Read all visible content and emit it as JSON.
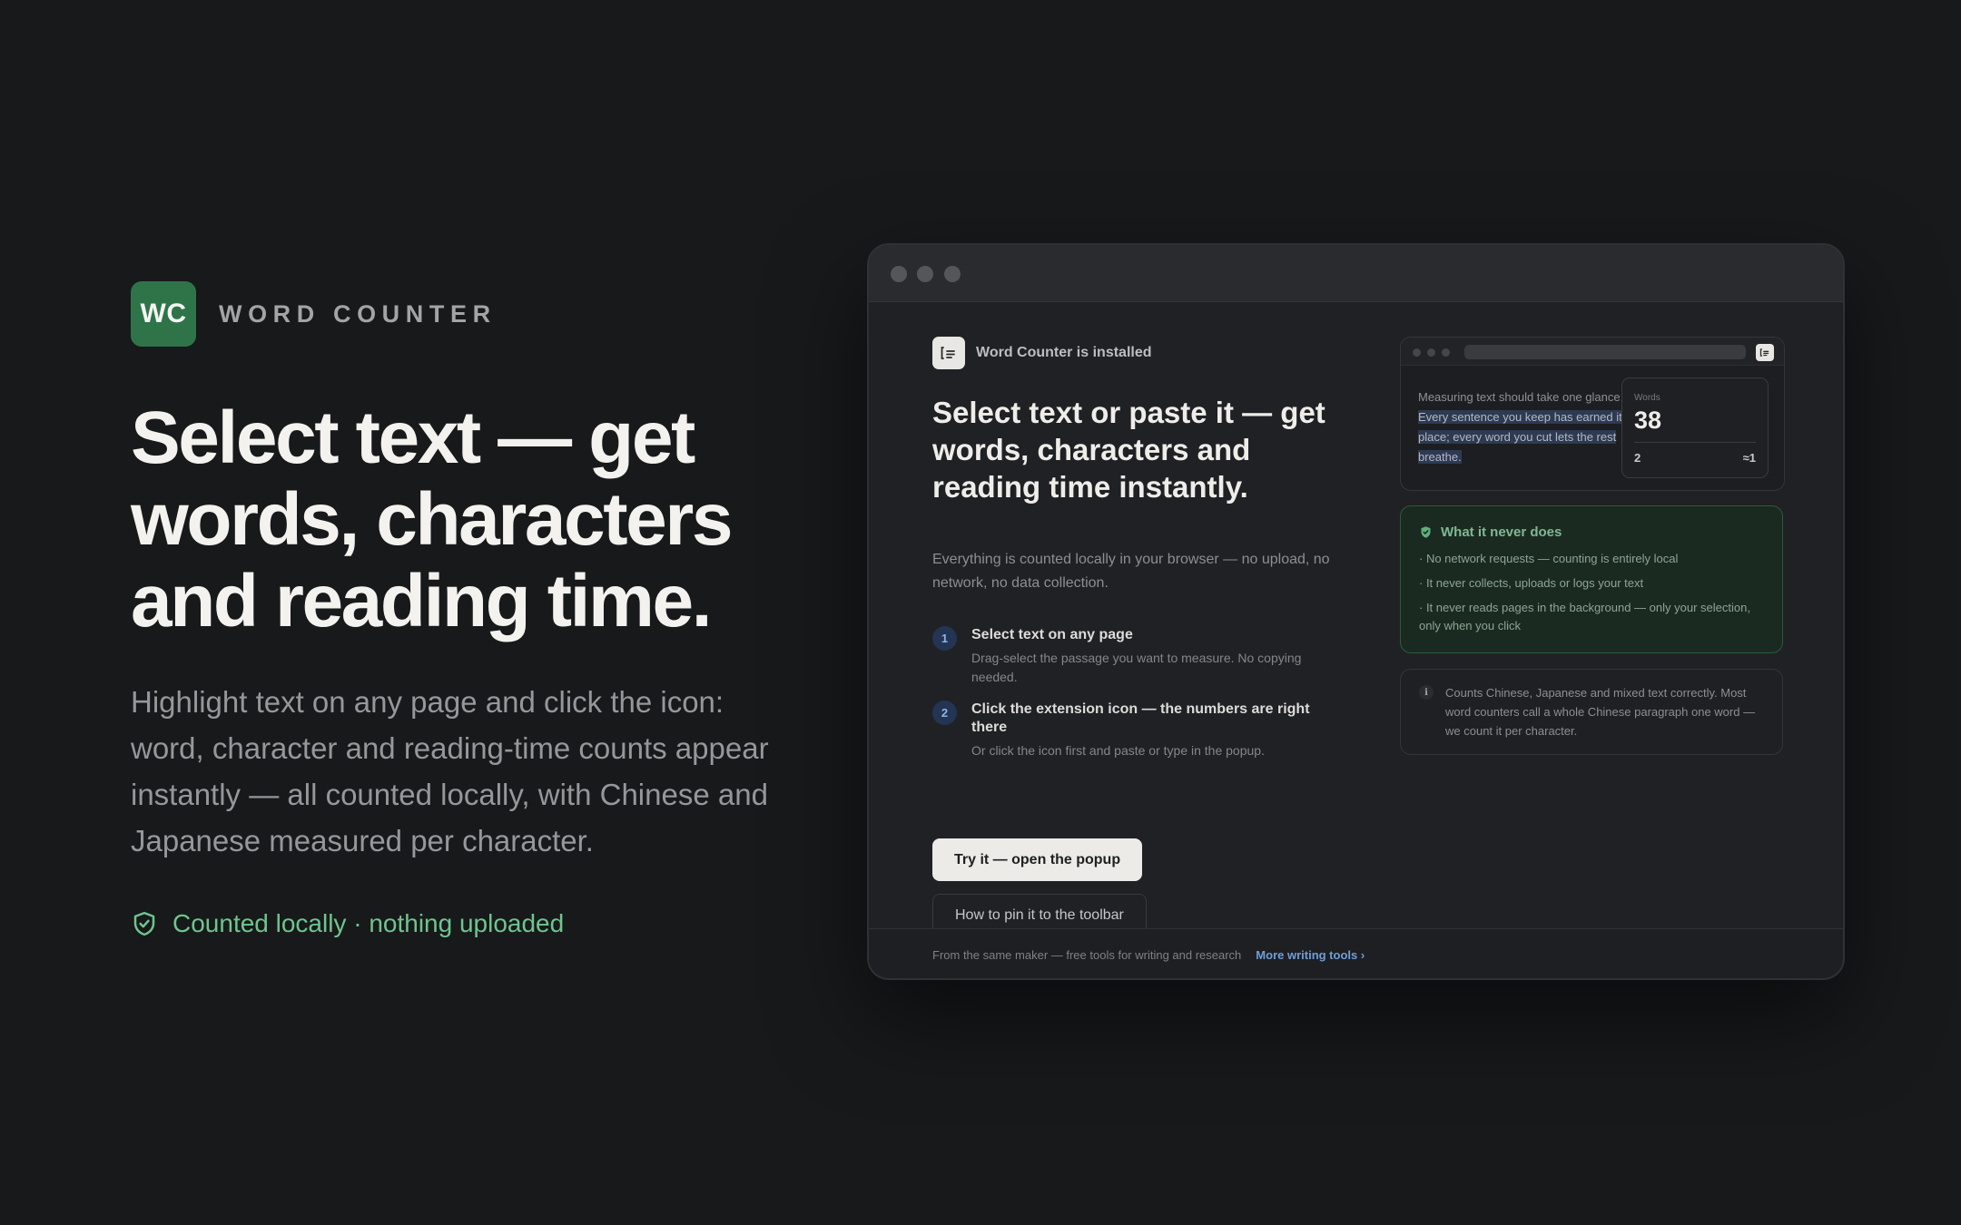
{
  "brand": {
    "logo_text": "WC",
    "name": "WORD COUNTER"
  },
  "hero": {
    "title": "Select text — get words, characters and reading time.",
    "subtitle": "Highlight text on any page and click the icon: word, character and reading-time counts appear instantly — all counted locally, with Chinese and Japanese measured per character.",
    "badge": "Counted locally · nothing uploaded"
  },
  "preview": {
    "installed": "Word Counter is installed",
    "title": "Select text or paste it — get words, characters and reading time instantly.",
    "subtitle": "Everything is counted locally in your browser — no upload, no network, no data collection.",
    "steps": [
      {
        "num": "1",
        "title": "Select text on any page",
        "desc": "Drag-select the passage you want to measure. No copying needed."
      },
      {
        "num": "2",
        "title": "Click the extension icon — the numbers are right there",
        "desc": "Or click the icon first and paste or type in the popup."
      }
    ],
    "primary_button": "Try it — open the popup",
    "secondary_button": "How to pin it to the toolbar",
    "mini": {
      "text_plain": "Measuring text should take one glance.",
      "text_highlight": "Every sentence you keep has earned it place; every word you cut lets the rest breathe.",
      "stats_label": "Words",
      "stats_value": "38",
      "stats_a": "2",
      "stats_b": "≈1"
    },
    "never": {
      "title": "What it never does",
      "items": [
        "· No network requests — counting is entirely local",
        "· It never collects, uploads or logs your text",
        "· It never reads pages in the background — only your selection, only when you click"
      ]
    },
    "info": {
      "icon": "i",
      "text": "Counts Chinese, Japanese and mixed text correctly. Most word counters call a whole Chinese paragraph one word — we count it per character."
    },
    "footer": {
      "text": "From the same maker — free tools for writing and research",
      "link": "More writing tools ›"
    }
  },
  "colors": {
    "background": "#18191b",
    "brand_green": "#2f7448",
    "accent_green": "#6ec58e",
    "link_blue": "#6f9ed8"
  },
  "icons": {
    "badge": "shield-check-icon",
    "extension": "word-counter-icon",
    "never": "shield-check-icon",
    "info": "info-icon"
  }
}
